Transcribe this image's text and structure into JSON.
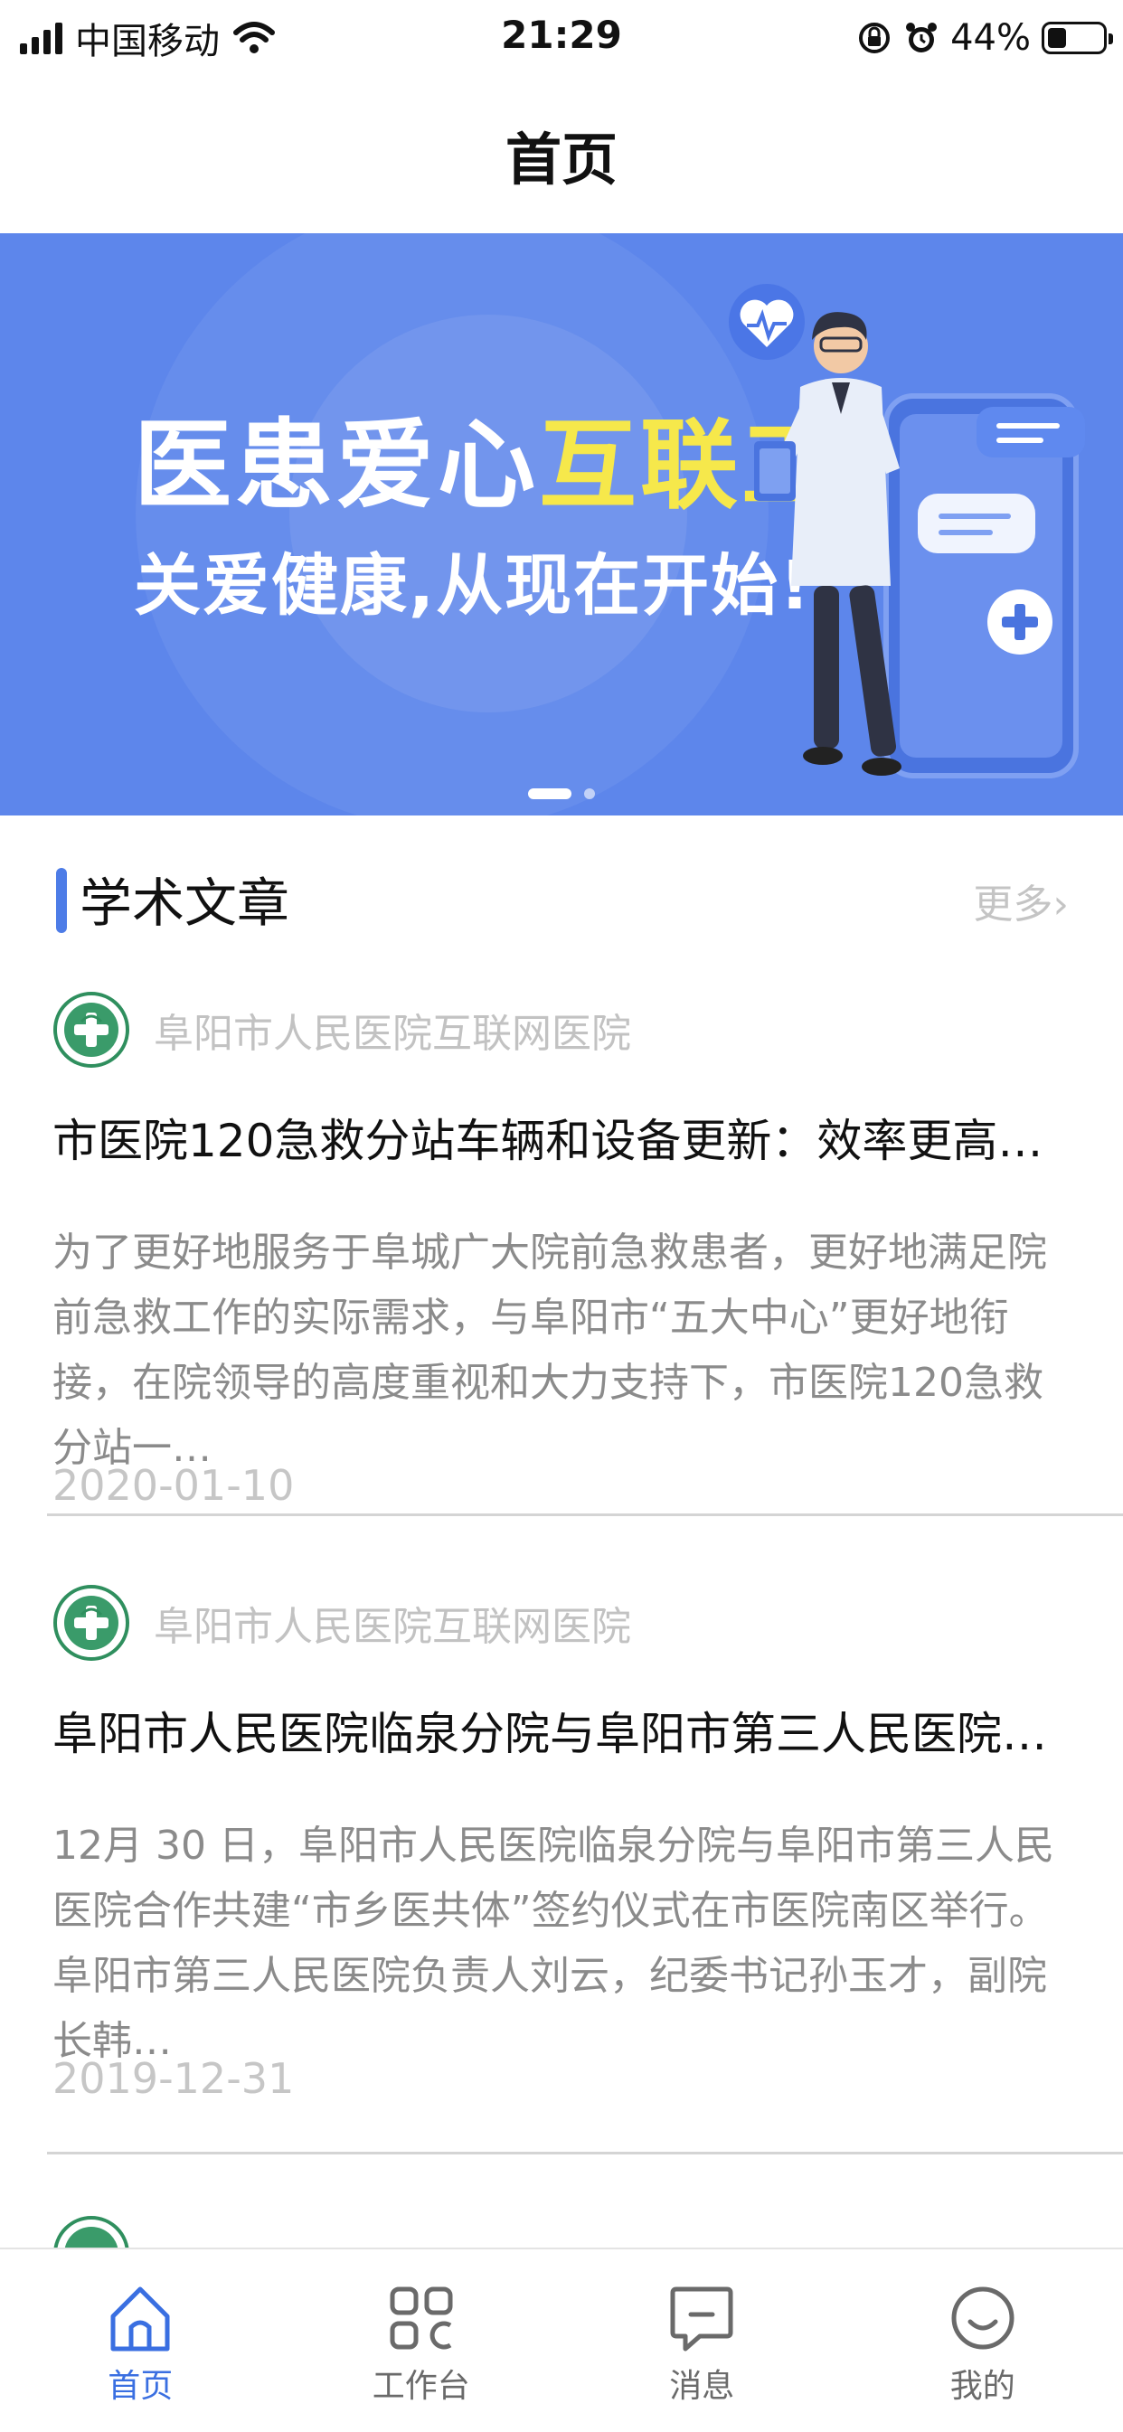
{
  "status_bar": {
    "carrier": "中国移动",
    "time": "21:29",
    "battery": "44%"
  },
  "nav": {
    "title": "首页"
  },
  "banner": {
    "headline_white": "医患爱心",
    "headline_accent": "互联工具",
    "subline": "关爱健康,从现在开始!",
    "accent_color": "#f6e84b",
    "background_color": "#5d86eb",
    "pages": 2,
    "active_page": 1
  },
  "section": {
    "title": "学术文章",
    "more": "更多"
  },
  "articles": [
    {
      "source": "阜阳市人民医院互联网医院",
      "title": "市医院120急救分站车辆和设备更新：效率更高…",
      "excerpt": "为了更好地服务于阜城广大院前急救患者，更好地满足院前急救工作的实际需求，与阜阳市“五大中心”更好地衔接，在院领导的高度重视和大力支持下，市医院120急救分站一…",
      "date": "2020-01-10"
    },
    {
      "source": "阜阳市人民医院互联网医院",
      "title": "阜阳市人民医院临泉分院与阜阳市第三人民医院…",
      "excerpt": "12月 30 日，阜阳市人民医院临泉分院与阜阳市第三人民医院合作共建“市乡医共体”签约仪式在市医院南区举行。阜阳市第三人民医院负责人刘云，纪委书记孙玉才，副院长韩…",
      "date": "2019-12-31"
    }
  ],
  "tabs": [
    {
      "label": "首页",
      "icon": "home-icon",
      "active": true
    },
    {
      "label": "工作台",
      "icon": "grid-icon",
      "active": false
    },
    {
      "label": "消息",
      "icon": "message-icon",
      "active": false
    },
    {
      "label": "我的",
      "icon": "profile-icon",
      "active": false
    }
  ],
  "colors": {
    "accent": "#3a6fe1",
    "section_bar": "#4d7ce7"
  }
}
